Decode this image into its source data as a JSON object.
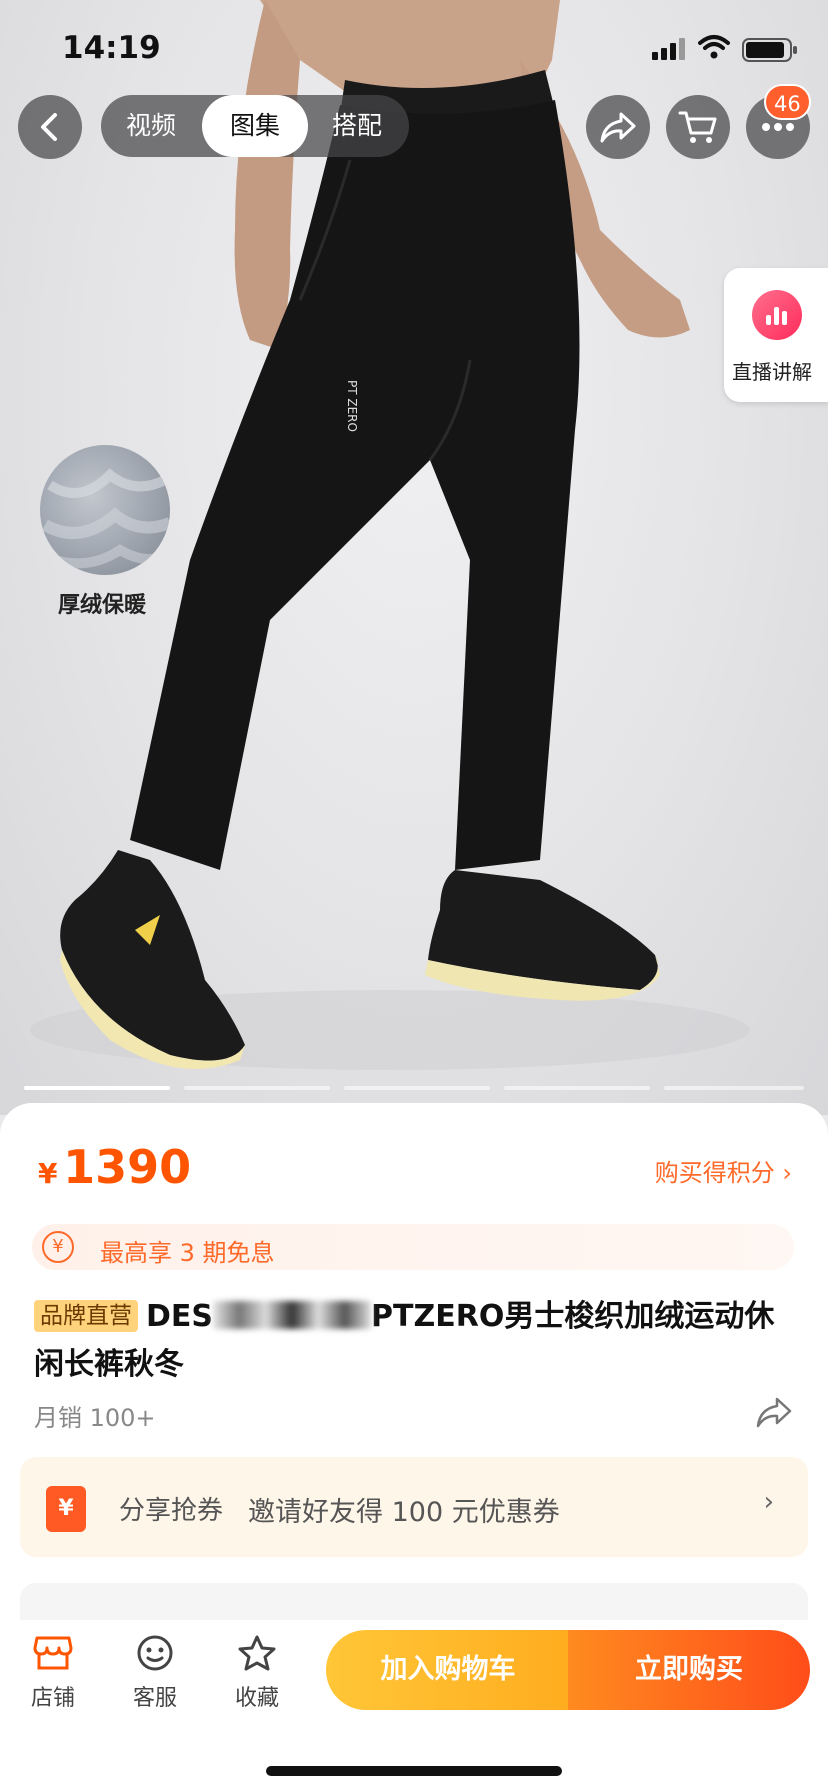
{
  "status_bar": {
    "time": "14:19"
  },
  "nav": {
    "tabs": [
      "视频",
      "图集",
      "搭配"
    ],
    "active_tab": "图集",
    "cart_badge": "46"
  },
  "overlay": {
    "live_label": "直播讲解",
    "feature_label": "厚绒保暖",
    "pants_logo": "PT ZERO"
  },
  "gallery": {
    "total_pages": 5,
    "current_page": 1
  },
  "product": {
    "currency": "¥",
    "price": "1390",
    "points_link": "购买得积分 ›",
    "installment": "最高享 3 期免息",
    "installment_icon": "¥",
    "brand_tag": "品牌直营",
    "title_start": "DES",
    "title_end": "PTZERO男士梭织加绒运动休闲长裤秋冬",
    "monthly_sales": "月销 100+"
  },
  "coupon": {
    "icon_text": "¥",
    "title": "分享抢券",
    "description": "邀请好友得 100 元优惠券",
    "arrow": "›"
  },
  "bottom_bar": {
    "store": "店铺",
    "service": "客服",
    "favorite": "收藏",
    "add_to_cart": "加入购物车",
    "buy_now": "立即购买"
  },
  "colors": {
    "accent": "#ff5500",
    "cart_button": "#ffb82a",
    "buy_button": "#ff5a1c",
    "badge": "#ff5f2d"
  }
}
